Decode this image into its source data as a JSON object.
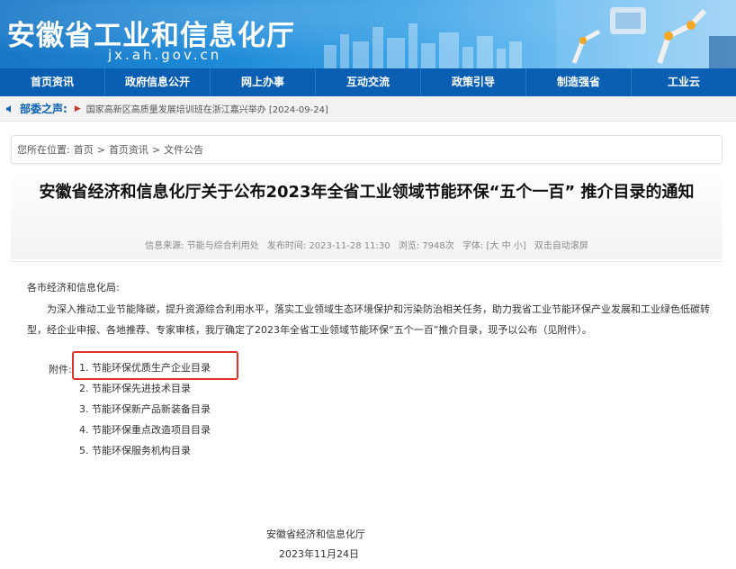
{
  "header": {
    "site_title": "安徽省工业和信息化厅",
    "domain": "jx.ah.gov.cn"
  },
  "nav": {
    "items": [
      "首页资讯",
      "政府信息公开",
      "网上办事",
      "互动交流",
      "政策引导",
      "制造强省",
      "工业云"
    ]
  },
  "ticker": {
    "label": "部委之声:",
    "news": "国家高新区高质量发展培训班在浙江嘉兴举办 [2024-09-24]"
  },
  "breadcrumb": {
    "prefix": "您所在位置:",
    "items": [
      "首页",
      ">",
      "首页资讯",
      ">",
      "文件公告"
    ]
  },
  "article": {
    "title": "安徽省经济和信息化厅关于公布2023年全省工业领域节能环保“五个一百” 推介目录的通知",
    "meta": {
      "source": "信息来源: 节能与综合利用处",
      "published": "发布时间: 2023-11-28 11:30",
      "views": "浏览: 7948次",
      "font": "字体: [大 中 小]",
      "autoscroll": "双击自动滚屏"
    },
    "salutation": "各市经济和信息化局:",
    "paragraph": "为深入推动工业节能降碳，提升资源综合利用水平，落实工业领域生态环境保护和污染防治相关任务，助力我省工业节能环保产业发展和工业绿色低碳转型，经企业申报、各地推荐、专家审核，我厅确定了2023年全省工业领域节能环保“五个一百”推介目录，现予以公布（见附件）。",
    "attachments_label": "附件:",
    "attachments": [
      "1. 节能环保优质生产企业目录",
      "2. 节能环保先进技术目录",
      "3. 节能环保新产品新装备目录",
      "4. 节能环保重点改造项目目录",
      "5. 节能环保服务机构目录"
    ],
    "signature": "安徽省经济和信息化厅",
    "date": "2023年11月24日"
  },
  "colors": {
    "nav_bg": "#0b5fb2",
    "highlight_border": "#e2332b",
    "ticker_label": "#0b5fb2"
  }
}
